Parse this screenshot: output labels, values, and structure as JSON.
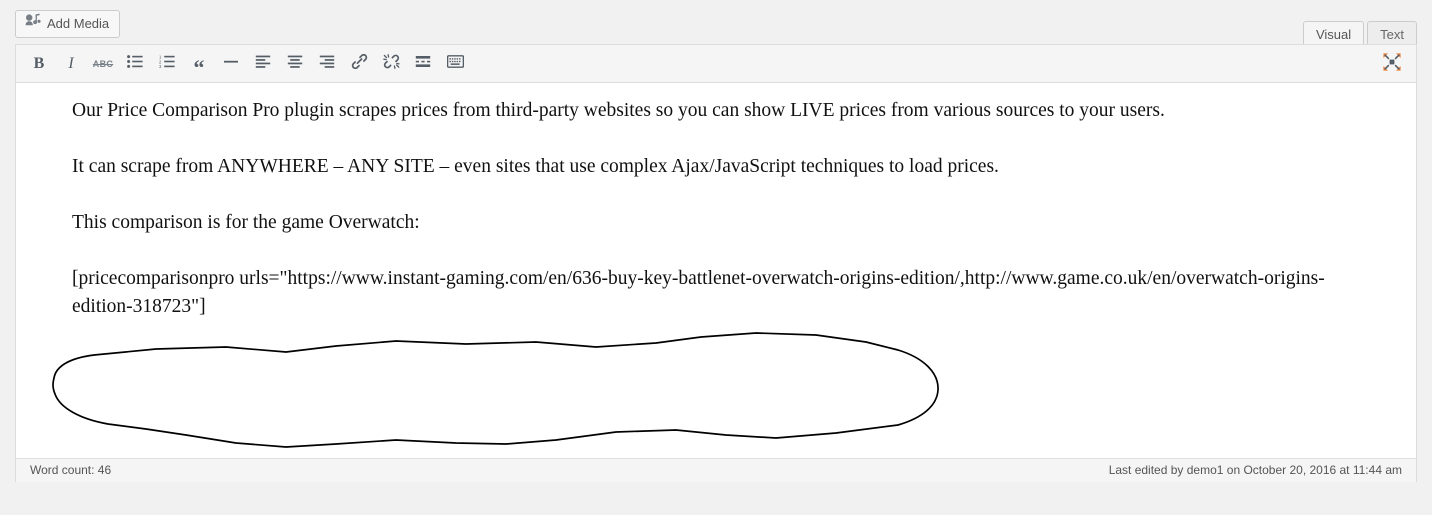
{
  "toolbar_top": {
    "add_media_label": "Add Media",
    "add_media_icon": "media-icon"
  },
  "editor_tabs": [
    {
      "label": "Visual",
      "active": true
    },
    {
      "label": "Text",
      "active": false
    }
  ],
  "format_toolbar": {
    "buttons": [
      {
        "name": "bold-button",
        "icon": "bold-icon",
        "label": "B"
      },
      {
        "name": "italic-button",
        "icon": "italic-icon",
        "label": "I"
      },
      {
        "name": "strikethrough-button",
        "icon": "strikethrough-icon",
        "label": "ABC"
      },
      {
        "name": "bulleted-list-button",
        "icon": "bulleted-list-icon",
        "label": ""
      },
      {
        "name": "numbered-list-button",
        "icon": "numbered-list-icon",
        "label": ""
      },
      {
        "name": "blockquote-button",
        "icon": "blockquote-icon",
        "label": ""
      },
      {
        "name": "horizontal-rule-button",
        "icon": "horizontal-rule-icon",
        "label": ""
      },
      {
        "name": "align-left-button",
        "icon": "align-left-icon",
        "label": ""
      },
      {
        "name": "align-center-button",
        "icon": "align-center-icon",
        "label": ""
      },
      {
        "name": "align-right-button",
        "icon": "align-right-icon",
        "label": ""
      },
      {
        "name": "insert-link-button",
        "icon": "link-icon",
        "label": ""
      },
      {
        "name": "remove-link-button",
        "icon": "unlink-icon",
        "label": ""
      },
      {
        "name": "read-more-button",
        "icon": "read-more-icon",
        "label": ""
      },
      {
        "name": "toolbar-toggle-button",
        "icon": "keyboard-toolbar-icon",
        "label": ""
      }
    ],
    "fullscreen_icon": "fullscreen-icon"
  },
  "post_content": {
    "paragraph_1": "Our Price Comparison Pro plugin scrapes prices from third-party websites so you can show LIVE prices from various sources to your users.",
    "paragraph_2": "It can scrape from ANYWHERE – ANY SITE – even sites that use complex Ajax/JavaScript techniques to load prices.",
    "paragraph_3": "This comparison is for the game Overwatch:",
    "paragraph_4": "[pricecomparisonpro urls=\"https://www.instant-gaming.com/en/636-buy-key-battlenet-overwatch-origins-edition/,http://www.game.co.uk/en/overwatch-origins-edition-318723\"]"
  },
  "annotation": {
    "shape": "hand-drawn-ellipse",
    "color": "#000000",
    "target": "shortcode paragraph"
  },
  "status_bar": {
    "word_count": "Word count: 46",
    "last_edited": "Last edited by demo1 on October 20, 2016 at 11:44 am"
  },
  "colors": {
    "page_background": "#f1f1f1",
    "editor_background": "#ffffff",
    "toolbar_background": "#f5f5f5",
    "border": "#dddddd",
    "icon": "#555d66",
    "text": "#111111",
    "muted_text": "#555555"
  }
}
